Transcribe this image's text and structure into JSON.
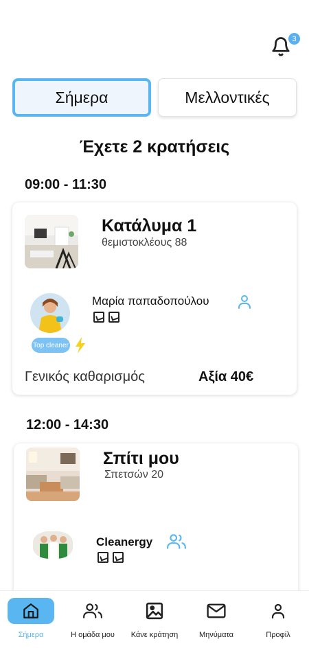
{
  "notifications": {
    "count": "3"
  },
  "tabs": [
    {
      "label": "Σήμερα",
      "active": true
    },
    {
      "label": "Μελλοντικές",
      "active": false
    }
  ],
  "heading": "Έχετε 2 κρατήσεις",
  "bookings": [
    {
      "time": "09:00 - 11:30",
      "property_title": "Κατάλυμα  1",
      "property_address": "θεμιστοκλέους 88",
      "cleaner_name": "Μαρία παπαδοπούλου",
      "cleaner_type_icon": "person-icon",
      "badge": "Top cleaner",
      "service": "Γενικός καθαρισμός",
      "price": "Αξία 40€"
    },
    {
      "time": "12:00 - 14:30",
      "property_title": "Σπίτι μου",
      "property_address": "Σπετσών 20",
      "cleaner_name": "Cleanergy",
      "cleaner_type_icon": "team-icon"
    }
  ],
  "nav": [
    {
      "label": "Σήμερα",
      "icon": "home-icon",
      "active": true
    },
    {
      "label": "Η ομάδα μου",
      "icon": "team-icon",
      "active": false
    },
    {
      "label": "Κάνε κράτηση",
      "icon": "image-icon",
      "active": false
    },
    {
      "label": "Μηνύματα",
      "icon": "mail-icon",
      "active": false
    },
    {
      "label": "Προφίλ",
      "icon": "user-icon",
      "active": false
    }
  ],
  "colors": {
    "accent": "#5ab6f0",
    "badge": "#7cc2f2",
    "lightning": "#f4d21f"
  }
}
